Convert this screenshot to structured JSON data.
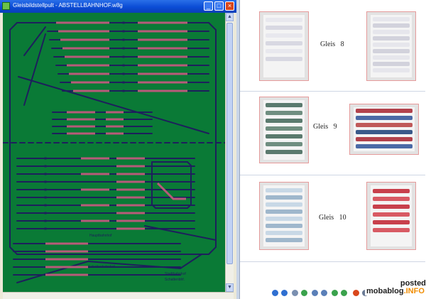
{
  "window": {
    "title": "Gleisbildstellpult - ABSTELLBAHNHOF.w8g",
    "minimize_glyph": "_",
    "maximize_glyph": "□",
    "close_glyph": "×",
    "scroll_up_glyph": "▲",
    "scroll_down_glyph": "▼"
  },
  "diagram": {
    "background": "#0a7a36",
    "track_color": "#1d1f5c",
    "occupied_color": "#b85a7a",
    "labels": {
      "hauptbahnhof": "Hauptbahnhof",
      "schattenbahnhof": "Schattenbahnhof",
      "stadtbahnhof": "Stadtbahnhof",
      "schattenbhf": "Schattenbhf."
    }
  },
  "right_panel": {
    "gleise": [
      {
        "label": "Gleis",
        "number": "8"
      },
      {
        "label": "Gleis",
        "number": "9"
      },
      {
        "label": "Gleis",
        "number": "10"
      }
    ]
  },
  "toolbar": {
    "icons": [
      "back-icon",
      "forward-icon",
      "rewind-icon",
      "play-icon",
      "zoom-in-icon",
      "zoom-out-icon",
      "rotate-icon",
      "delete-icon",
      "print-icon",
      "help-icon"
    ]
  },
  "watermark": {
    "top": "posted",
    "brand": "mobablog",
    "brand_suffix": ".INFO"
  },
  "colors": {
    "titlebar": "#0b4cd6",
    "accent_red": "#d9471c",
    "photo_border": "#e59a9a"
  }
}
